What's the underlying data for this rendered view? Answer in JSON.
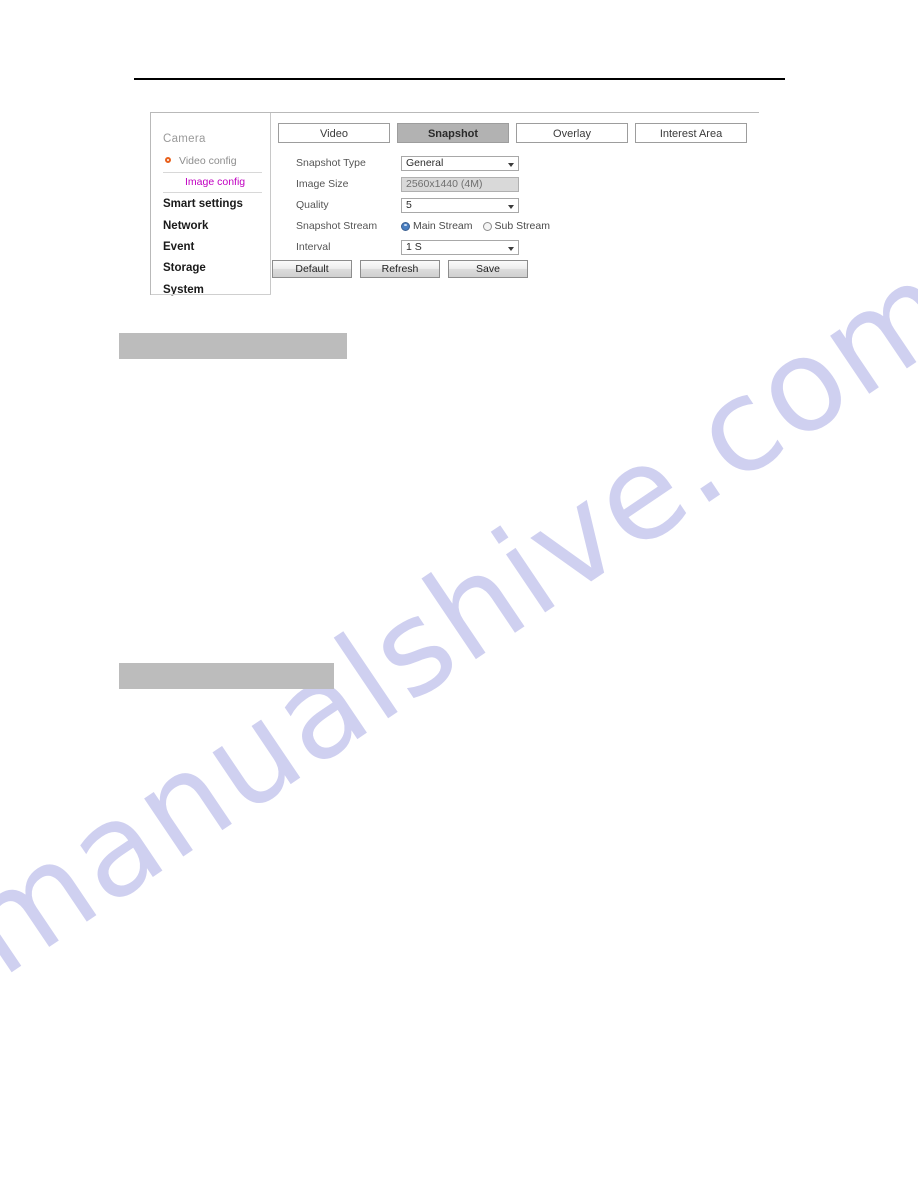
{
  "document": {
    "watermark_text": "manualshive.com",
    "redaction_bars": [
      {
        "name": "heading-redaction-upper"
      },
      {
        "name": "heading-redaction-lower"
      }
    ]
  },
  "camera_ui": {
    "sidebar": {
      "group_title": "Camera",
      "sub_items": [
        {
          "label": "Video config",
          "active": false,
          "bullet": "radio-bullet-icon"
        },
        {
          "label": "Image config",
          "active": true
        }
      ],
      "items": [
        {
          "label": "Smart settings"
        },
        {
          "label": "Network"
        },
        {
          "label": "Event"
        },
        {
          "label": "Storage"
        },
        {
          "label": "System"
        }
      ]
    },
    "tabs": [
      {
        "label": "Video",
        "active": false
      },
      {
        "label": "Snapshot",
        "active": true
      },
      {
        "label": "Overlay",
        "active": false
      },
      {
        "label": "Interest Area",
        "active": false
      }
    ],
    "form": {
      "snapshot_type": {
        "label": "Snapshot Type",
        "value": "General"
      },
      "image_size": {
        "label": "Image Size",
        "value": "2560x1440 (4M)"
      },
      "quality": {
        "label": "Quality",
        "value": "5"
      },
      "snapshot_stream": {
        "label": "Snapshot Stream",
        "options": [
          {
            "label": "Main Stream",
            "selected": true
          },
          {
            "label": "Sub Stream",
            "selected": false
          }
        ]
      },
      "interval": {
        "label": "Interval",
        "value": "1 S"
      }
    },
    "buttons": {
      "default": "Default",
      "refresh": "Refresh",
      "save": "Save"
    }
  },
  "colors": {
    "tab_active_bg": "#b2b2b2",
    "active_nav_text": "#c000c0",
    "bullet_orange": "#e8601c",
    "radio_selected": "#4a7fc1",
    "redaction_gray": "#bcbcbc",
    "watermark": "#c9caee"
  }
}
